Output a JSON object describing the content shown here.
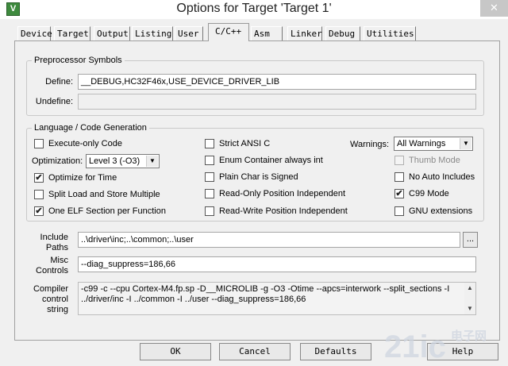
{
  "window": {
    "title": "Options for Target 'Target 1'",
    "icon": "V",
    "close": "✕"
  },
  "tabs": [
    "Device",
    "Target",
    "Output",
    "Listing",
    "User",
    "C/C++",
    "Asm",
    "Linker",
    "Debug",
    "Utilities"
  ],
  "active_tab": "C/C++",
  "preprocessor": {
    "title": "Preprocessor Symbols",
    "define_label": "Define:",
    "define_value": "__DEBUG,HC32F46x,USE_DEVICE_DRIVER_LIB",
    "undefine_label": "Undefine:",
    "undefine_value": ""
  },
  "language": {
    "title": "Language / Code Generation",
    "execute_only": {
      "label": "Execute-only Code",
      "checked": false
    },
    "optimization_label": "Optimization:",
    "optimization_value": "Level 3 (-O3)",
    "optimize_time": {
      "label": "Optimize for Time",
      "checked": true
    },
    "split_load": {
      "label": "Split Load and Store Multiple",
      "checked": false
    },
    "one_elf": {
      "label": "One ELF Section per Function",
      "checked": true
    },
    "strict_ansi": {
      "label": "Strict ANSI C",
      "checked": false
    },
    "enum_container": {
      "label": "Enum Container always int",
      "checked": false
    },
    "plain_char": {
      "label": "Plain Char is Signed",
      "checked": false
    },
    "ro_pi": {
      "label": "Read-Only Position Independent",
      "checked": false
    },
    "rw_pi": {
      "label": "Read-Write Position Independent",
      "checked": false
    },
    "warnings_label": "Warnings:",
    "warnings_value": "All Warnings",
    "thumb_mode": {
      "label": "Thumb Mode",
      "checked": false,
      "disabled": true
    },
    "no_auto_includes": {
      "label": "No Auto Includes",
      "checked": false
    },
    "c99_mode": {
      "label": "C99 Mode",
      "checked": true
    },
    "gnu_extensions": {
      "label": "GNU extensions",
      "checked": false
    }
  },
  "include": {
    "label_line1": "Include",
    "label_line2": "Paths",
    "value": "..\\driver\\inc;..\\common;..\\user",
    "browse": "..."
  },
  "misc": {
    "label_line1": "Misc",
    "label_line2": "Controls",
    "value": "--diag_suppress=186,66"
  },
  "compiler": {
    "label_line1": "Compiler",
    "label_line2": "control",
    "label_line3": "string",
    "value": "-c99 -c --cpu Cortex-M4.fp.sp -D__MICROLIB -g -O3 -Otime --apcs=interwork --split_sections -I ../driver/inc -I ../common -I ../user --diag_suppress=186,66"
  },
  "buttons": {
    "ok": "OK",
    "cancel": "Cancel",
    "defaults": "Defaults",
    "help": "Help"
  },
  "watermark": {
    "brand": "21ic",
    "cn": "电子网"
  },
  "check_mark": "✔"
}
